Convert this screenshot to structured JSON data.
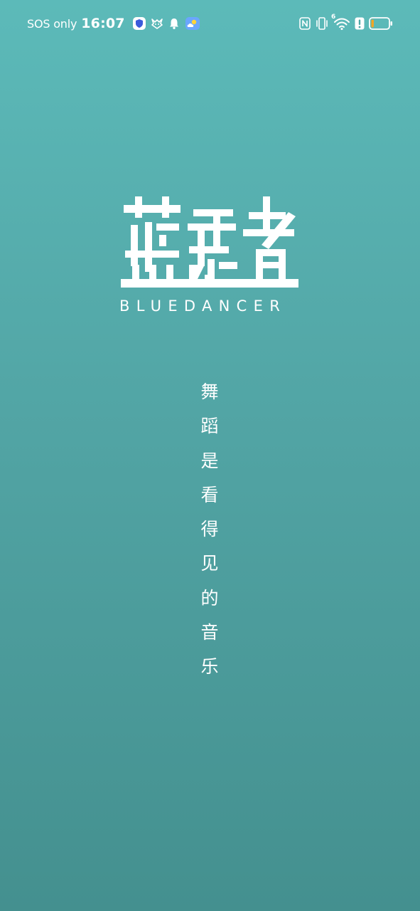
{
  "status_bar": {
    "carrier": "SOS only",
    "time": "16:07",
    "left_icons": [
      "shield-app-icon",
      "dragon-app-icon",
      "bell-icon",
      "weather-icon"
    ],
    "right_icons": [
      "nfc-icon",
      "vibrate-icon",
      "wifi-icon",
      "alert-icon",
      "battery-icon"
    ],
    "wifi_badge": "6",
    "battery_level": 0.15,
    "battery_color": "#f5a623"
  },
  "brand": {
    "english_name": "BLUEDANCER"
  },
  "slogan": {
    "chars": [
      "舞",
      "蹈",
      "是",
      "看",
      "得",
      "见",
      "的",
      "音",
      "乐"
    ]
  },
  "colors": {
    "background_top": "#5cbab9",
    "background_bottom": "#44908f",
    "foreground": "#ffffff"
  }
}
